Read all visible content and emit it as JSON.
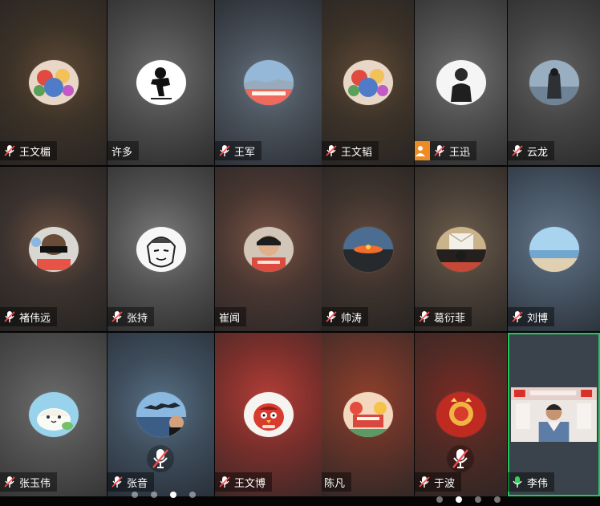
{
  "participants": [
    {
      "name": "王文楣"
    },
    {
      "name": "许多"
    },
    {
      "name": "王军"
    },
    {
      "name": "褚伟远"
    },
    {
      "name": "张持"
    },
    {
      "name": "崔闻"
    },
    {
      "name": "张玉伟"
    },
    {
      "name": "张音"
    },
    {
      "name": "王文博"
    },
    {
      "name": "王文韬"
    },
    {
      "name": "王迅"
    },
    {
      "name": "云龙"
    },
    {
      "name": "帅涛"
    },
    {
      "name": "葛衍菲"
    },
    {
      "name": "刘博"
    },
    {
      "name": "陈凡"
    },
    {
      "name": "于波"
    },
    {
      "name": "李伟"
    }
  ],
  "pagination": {
    "left_active_page": 3,
    "right_active_page": 2,
    "total_pages": 4
  },
  "colors": {
    "active_speaker_border": "#22c55e",
    "mute_slash": "#ff4a4a",
    "user_badge": "#f08a24",
    "active_mic": "#35d35a"
  },
  "icons": {
    "muted": "mic-muted-icon",
    "active": "mic-active-icon",
    "user": "user-icon"
  }
}
